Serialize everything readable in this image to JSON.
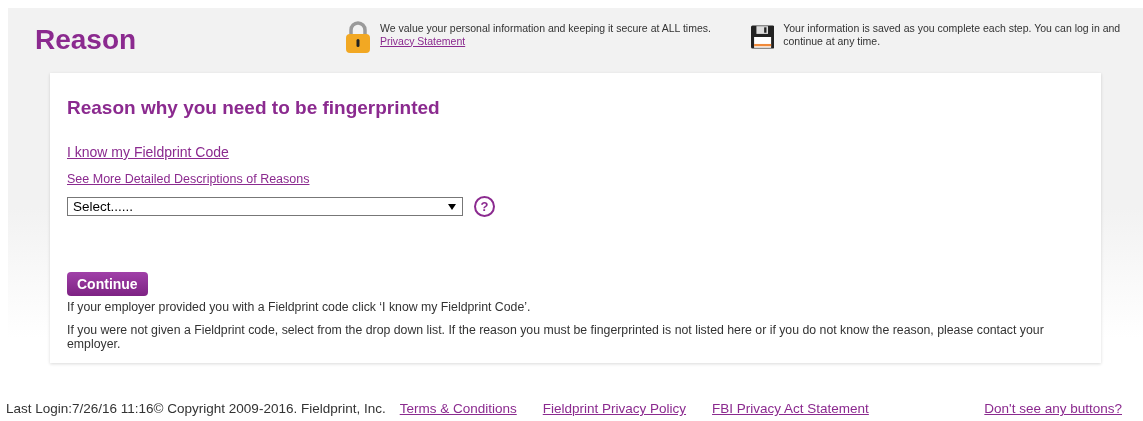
{
  "header": {
    "title": "Reason",
    "security_note": {
      "text": "We value your personal information and keeping it secure at ALL times.",
      "link": "Privacy Statement"
    },
    "save_note": "Your information is saved as you complete each step. You can log in and continue at any time."
  },
  "form": {
    "heading": "Reason why you need to be fingerprinted",
    "links": [
      "I know my Fieldprint Code",
      "See More Detailed Descriptions of Reasons"
    ],
    "reason_select": {
      "value": "Select......"
    },
    "help": "?",
    "continue_button": "Continue",
    "notes": [
      "If your employer provided you with a Fieldprint code click ‘I know my Fieldprint Code’.",
      "If you were not given a Fieldprint code, select from the drop down list. If the reason you must be fingerprinted is not listed here or if you do not know the reason, please contact your employer."
    ]
  },
  "footer": {
    "last_login": "Last Login:7/26/16 11:16© Copyright 2009-2016. Fieldprint, Inc.",
    "links": [
      "Terms & Conditions",
      "Fieldprint Privacy Policy",
      "FBI Privacy Act Statement"
    ],
    "help_link": "Don't see any buttons?"
  }
}
